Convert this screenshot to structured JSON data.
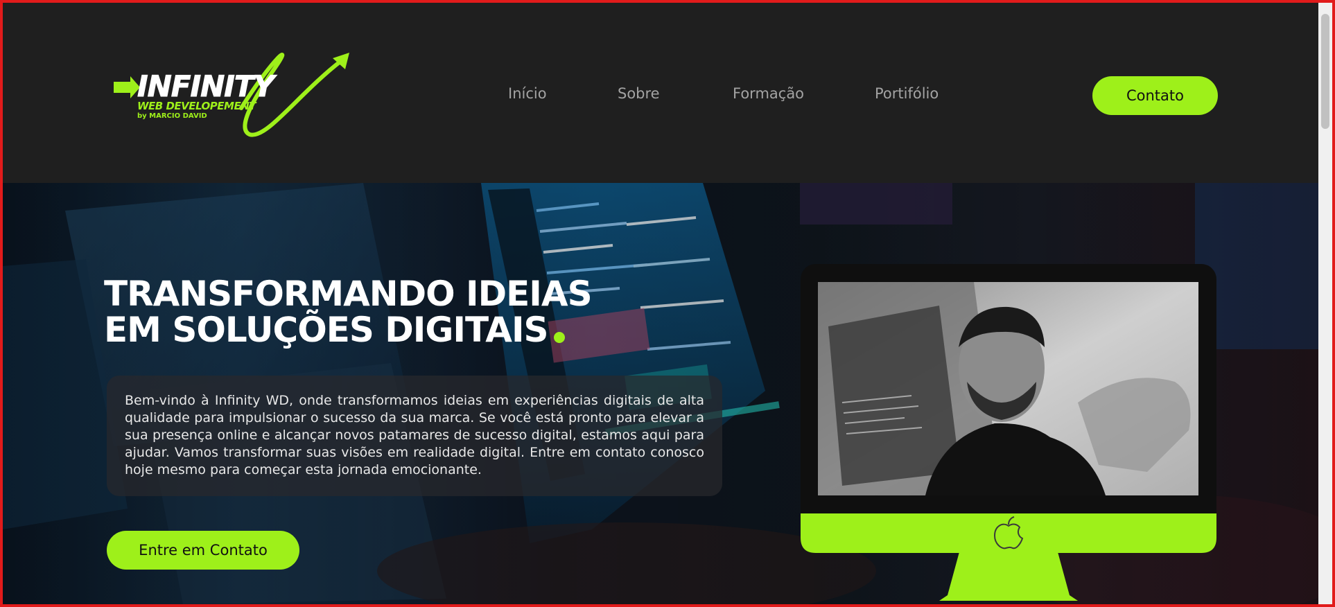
{
  "brand": {
    "logo_main": "INFINITY",
    "logo_sub": "WEB DEVELOPEMENT",
    "logo_by": "by MARCIO DAVID"
  },
  "nav": {
    "items": [
      {
        "label": "Início"
      },
      {
        "label": "Sobre"
      },
      {
        "label": "Formação"
      },
      {
        "label": "Portifólio"
      }
    ],
    "contact_label": "Contato"
  },
  "hero": {
    "headline_line1": "TRANSFORMANDO IDEIAS",
    "headline_line2": "EM SOLUÇÕES DIGITAIS",
    "intro": "Bem-vindo à Infinity WD, onde transformamos ideias em experiências digitais de alta qualidade para impulsionar o sucesso da sua marca. Se você está pronto para elevar a sua presença online e alcançar novos patamares de sucesso digital, estamos aqui para ajudar. Vamos transformar suas visões em realidade digital. Entre em contato conosco hoje mesmo para começar esta jornada emocionante.",
    "cta_label": "Entre em Contato"
  },
  "colors": {
    "accent": "#9ef01a",
    "header_bg": "#1f1f1f",
    "frame": "#e11b1b"
  },
  "icons": {
    "logo_arrow": "arrow-right-icon",
    "apple": "apple-icon"
  }
}
